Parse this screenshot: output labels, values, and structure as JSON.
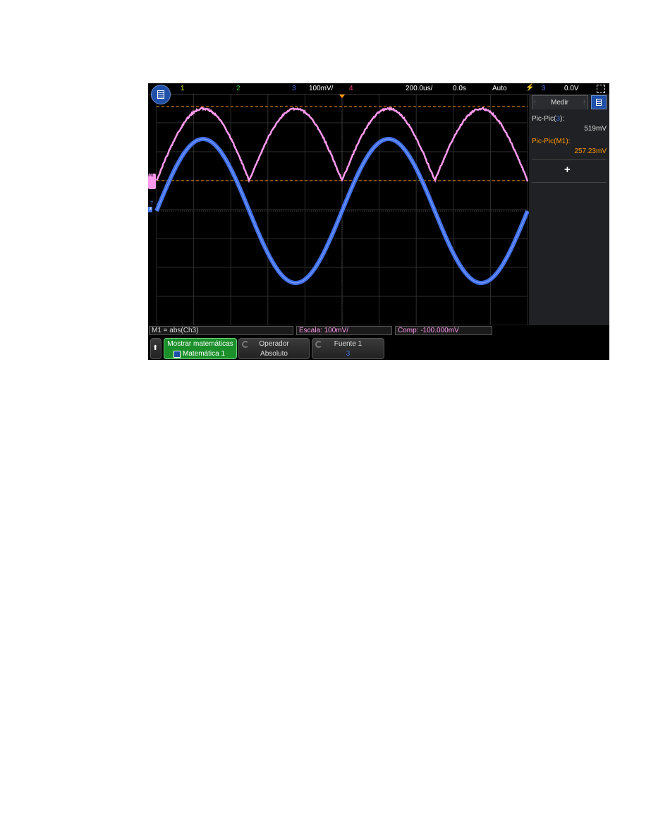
{
  "topbar": {
    "ch1": "1",
    "ch2": "2",
    "ch3": "3",
    "ch3_scale": "100mV/",
    "ch4": "4",
    "timebase": "200.0us/",
    "delay": "0.0s",
    "trigger_mode": "Auto",
    "trigger_source": "3",
    "trigger_level": "0.0V"
  },
  "markers": {
    "math": "M1",
    "ch3_ground": "3",
    "ch3_trig": "T"
  },
  "sidebar": {
    "tab_label": "Medir",
    "measurements": [
      {
        "label_pre": "Pic-Pic(",
        "source": "3",
        "label_post": "):",
        "value": "519mV"
      },
      {
        "label": "Pic-Pic(M1):",
        "value": "257.23mV"
      }
    ],
    "add_symbol": "+"
  },
  "infobar": {
    "function": "M1 = abs(Ch3)",
    "scale": "Escala: 100mV/",
    "offset": "Comp: -100.000mV"
  },
  "softkeys": {
    "back_symbol": "⬆",
    "show_math": {
      "title": "Mostrar matemáticas",
      "value": "Matemática 1"
    },
    "operator": {
      "title": "Operador",
      "value": "Absoluto"
    },
    "source": {
      "title": "Fuente 1",
      "value": "3"
    }
  },
  "colors": {
    "ch1": "#e6e600",
    "ch2": "#33cc33",
    "ch3": "#3f6fe6",
    "ch4": "#ff3d7f",
    "math": "#ff99ee",
    "cursor": "#ff9900",
    "softkey_active": "#1a8f2a"
  }
}
